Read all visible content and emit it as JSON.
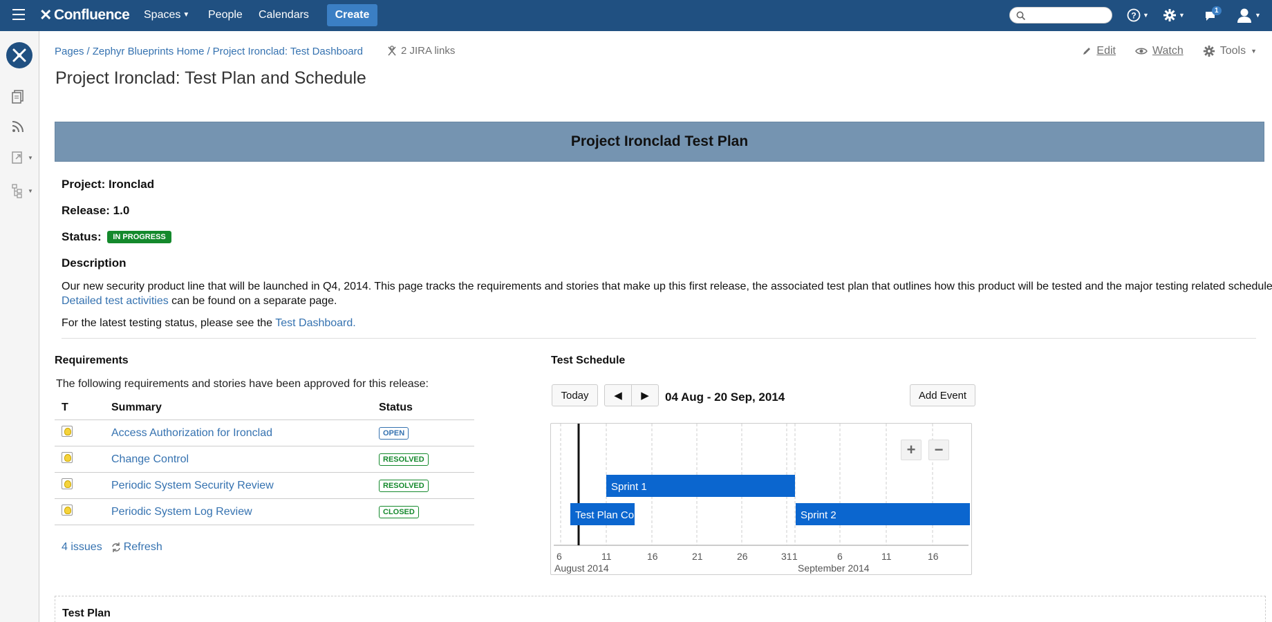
{
  "header": {
    "logo": "Confluence",
    "nav": [
      {
        "label": "Spaces",
        "has_caret": true
      },
      {
        "label": "People"
      },
      {
        "label": "Calendars"
      }
    ],
    "create_label": "Create",
    "notification_count": "1",
    "colors": {
      "header_bg": "#205081",
      "create_bg": "#3b7fc4"
    }
  },
  "sidebar": {
    "items": [
      "pages-icon",
      "blog-rss-icon",
      "shortcuts-icon",
      "page-tree-icon"
    ]
  },
  "breadcrumbs": [
    "Pages",
    "Zephyr Blueprints Home",
    "Project Ironclad: Test Dashboard"
  ],
  "jira_links": "2 JIRA links",
  "page_actions": {
    "edit": "Edit",
    "watch": "Watch",
    "tools": "Tools"
  },
  "page_title": "Project Ironclad: Test Plan and Schedule",
  "banner_title": "Project Ironclad Test Plan",
  "meta": {
    "project": "Project: Ironclad",
    "release": "Release: 1.0",
    "status_label": "Status:",
    "status_value": "IN PROGRESS",
    "description_heading": "Description"
  },
  "description": {
    "text_1": "Our new security product line that will be launched in Q4, 2014. This page tracks the requirements and stories that make up this first release, the associated test plan that outlines how this product will be tested and the major testing related schedules. ",
    "link": "Detailed test activities",
    "text_2": " can be found on a separate page."
  },
  "latest": {
    "text": "For the latest testing status, please see the ",
    "link": "Test Dashboard."
  },
  "requirements": {
    "heading": "Requirements",
    "intro": "The following requirements and stories have been approved for this release:",
    "columns": [
      "T",
      "Summary",
      "Status"
    ],
    "rows": [
      {
        "summary": "Access Authorization for Ironclad",
        "status": "OPEN"
      },
      {
        "summary": "Change Control",
        "status": "RESOLVED"
      },
      {
        "summary": "Periodic System Security Review",
        "status": "RESOLVED"
      },
      {
        "summary": "Periodic System Log Review",
        "status": "CLOSED"
      }
    ],
    "count": "4 issues",
    "refresh": "Refresh"
  },
  "schedule": {
    "heading": "Test Schedule",
    "today": "Today",
    "prev": "◀",
    "next": "▶",
    "range": "04 Aug - 20 Sep, 2014",
    "add_event": "Add Event",
    "ticks": [
      "6",
      "11",
      "16",
      "21",
      "26",
      "31",
      "1",
      "6",
      "11",
      "16"
    ],
    "months": [
      "August 2014",
      "September 2014"
    ],
    "events": [
      {
        "name": "Sprint 1"
      },
      {
        "name": "Test Plan Co"
      },
      {
        "name": "Sprint 2"
      }
    ],
    "bar_color": "#0b66cf"
  },
  "test_plan": {
    "heading": "Test Plan"
  }
}
